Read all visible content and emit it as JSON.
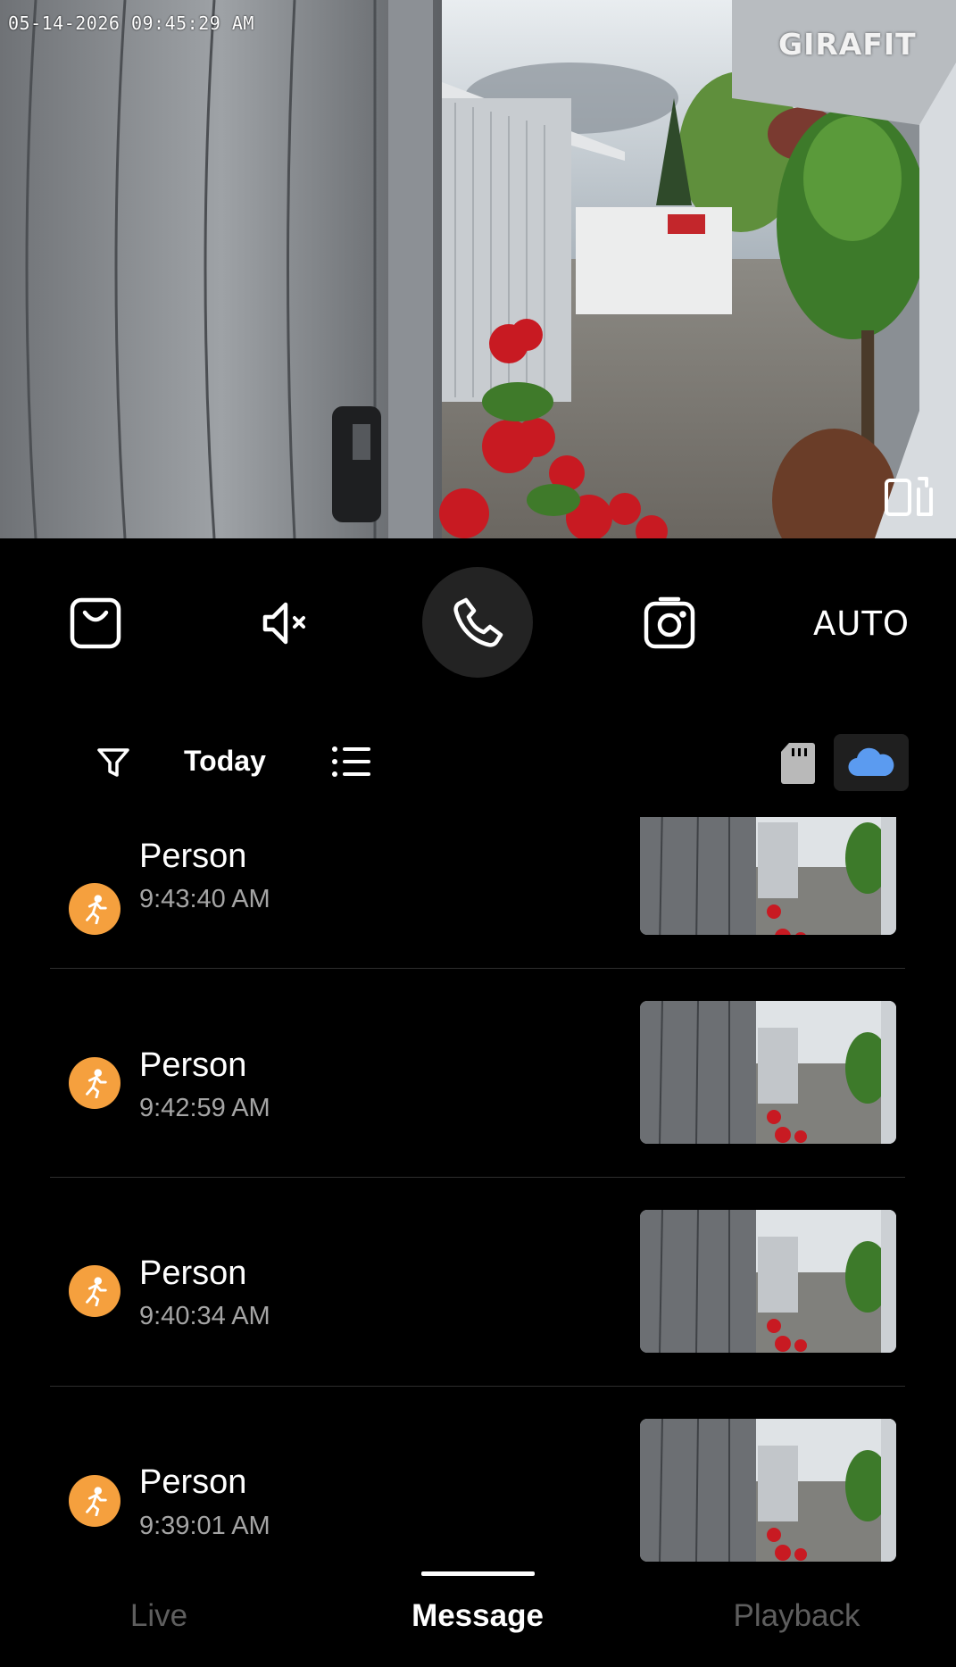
{
  "feed": {
    "timestamp": "05-14-2026 09:45:29 AM",
    "brand": "GIRAFIT"
  },
  "controls": {
    "bag_icon": "shopping-bag-icon",
    "mute_icon": "speaker-muted-icon",
    "call_icon": "phone-icon",
    "snapshot_icon": "camera-icon",
    "quality_label": "AUTO"
  },
  "filter_bar": {
    "date_label": "Today",
    "filter_icon": "funnel-icon",
    "list_icon": "list-icon",
    "sd_icon": "sd-card-icon",
    "cloud_icon": "cloud-icon",
    "cloud_color": "#5b9bf0"
  },
  "events": [
    {
      "title": "Person",
      "time": "9:43:40 AM",
      "icon": "running-person-icon"
    },
    {
      "title": "Person",
      "time": "9:42:59 AM",
      "icon": "running-person-icon"
    },
    {
      "title": "Person",
      "time": "9:40:34 AM",
      "icon": "running-person-icon"
    },
    {
      "title": "Person",
      "time": "9:39:01 AM",
      "icon": "running-person-icon"
    }
  ],
  "accent": {
    "event_badge": "#f5a03e"
  },
  "tabs": [
    {
      "label": "Live",
      "active": false
    },
    {
      "label": "Message",
      "active": true
    },
    {
      "label": "Playback",
      "active": false
    }
  ]
}
